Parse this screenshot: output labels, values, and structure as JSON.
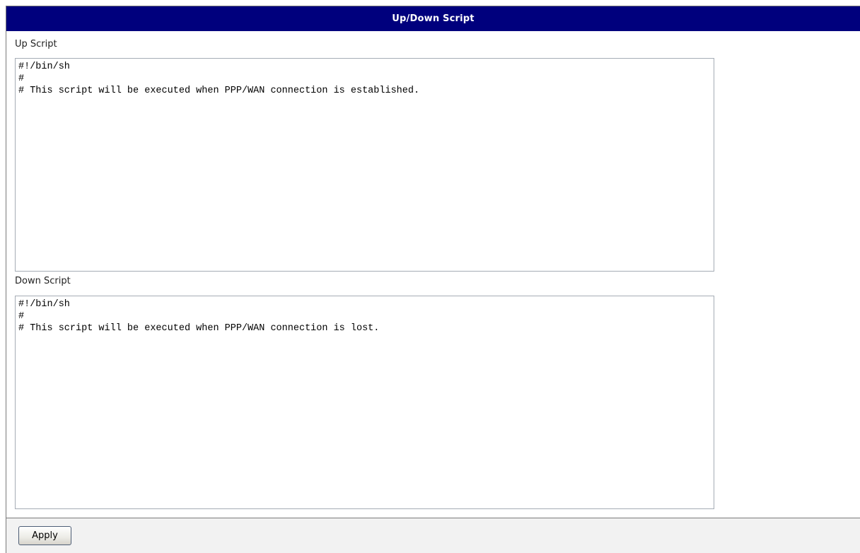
{
  "header": {
    "title": "Up/Down Script"
  },
  "up_script": {
    "label": "Up Script",
    "value": "#!/bin/sh\n#\n# This script will be executed when PPP/WAN connection is established."
  },
  "down_script": {
    "label": "Down Script",
    "value": "#!/bin/sh\n#\n# This script will be executed when PPP/WAN connection is lost."
  },
  "footer": {
    "apply_label": "Apply"
  },
  "colors": {
    "titlebar_bg": "#00007d",
    "titlebar_text": "#ffffff",
    "footer_bg": "#f2f2f2"
  }
}
